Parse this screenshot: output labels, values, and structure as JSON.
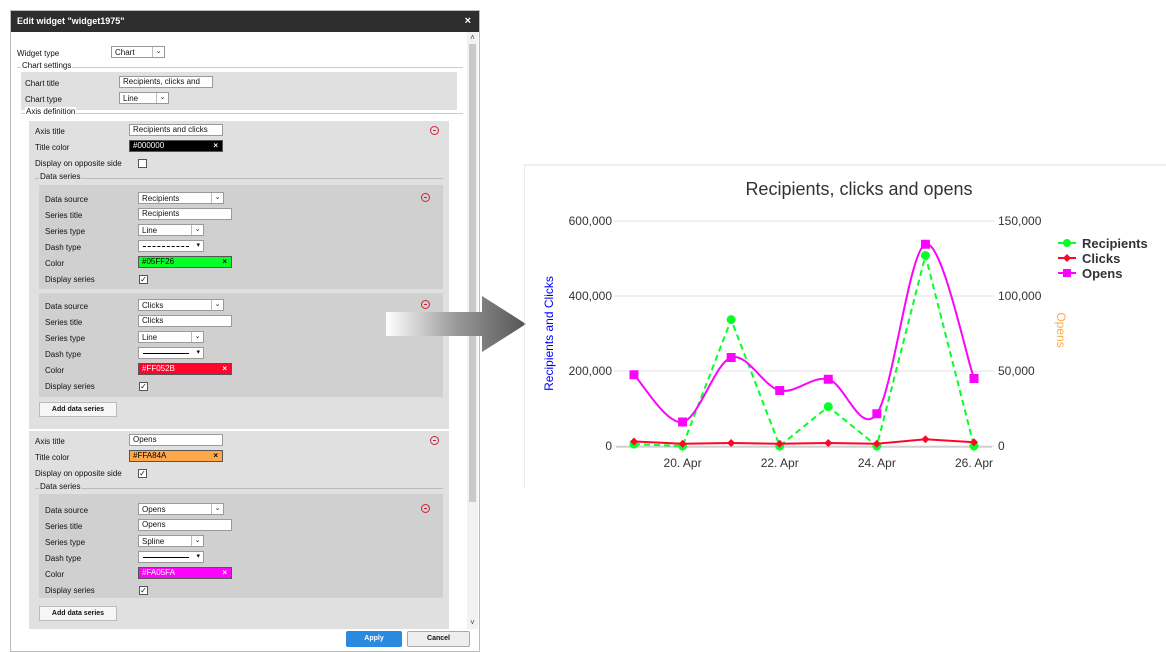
{
  "dialog": {
    "title": "Edit widget \"widget1975\"",
    "close": "×",
    "widget_type_label": "Widget type",
    "widget_type_value": "Chart",
    "chart_settings_legend": "Chart settings",
    "chart_title_label": "Chart title",
    "chart_title_value": "Recipients, clicks and",
    "chart_type_label": "Chart type",
    "chart_type_value": "Line",
    "axis_definition_legend": "Axis definition",
    "axes": [
      {
        "axis_title_label": "Axis title",
        "axis_title_value": "Recipients and clicks",
        "title_color_label": "Title color",
        "title_color_value": "#000000",
        "title_color_hex": "#000000",
        "opposite_label": "Display on opposite side",
        "opposite_checked": "",
        "data_series_legend": "Data series",
        "series": [
          {
            "ds_label": "Data source",
            "ds_value": "Recipients",
            "st_label": "Series title",
            "st_value": "Recipients",
            "type_label": "Series type",
            "type_value": "Line",
            "dash_label": "Dash type",
            "color_label": "Color",
            "color_value": "#05FF26",
            "color_hex": "#05FF26",
            "display_label": "Display series",
            "display_checked": "✓"
          },
          {
            "ds_label": "Data source",
            "ds_value": "Clicks",
            "st_label": "Series title",
            "st_value": "Clicks",
            "type_label": "Series type",
            "type_value": "Line",
            "dash_label": "Dash type",
            "color_label": "Color",
            "color_value": "#FF052B",
            "color_hex": "#FF052B",
            "display_label": "Display series",
            "display_checked": "✓"
          }
        ],
        "add_series": "Add data series"
      },
      {
        "axis_title_label": "Axis title",
        "axis_title_value": "Opens",
        "title_color_label": "Title color",
        "title_color_value": "#FFA84A",
        "title_color_hex": "#FFA84A",
        "opposite_label": "Display on opposite side",
        "opposite_checked": "✓",
        "data_series_legend": "Data series",
        "series": [
          {
            "ds_label": "Data source",
            "ds_value": "Opens",
            "st_label": "Series title",
            "st_value": "Opens",
            "type_label": "Series type",
            "type_value": "Spline",
            "dash_label": "Dash type",
            "color_label": "Color",
            "color_value": "#FA05FA",
            "color_hex": "#FA05FA",
            "display_label": "Display series",
            "display_checked": "✓"
          }
        ],
        "add_series": "Add data series"
      }
    ],
    "apply": "Apply",
    "cancel": "Cancel"
  },
  "chart_data": {
    "type": "line",
    "title": "Recipients, clicks and opens",
    "left_axis_title": "Recipients and Clicks",
    "left_axis_color": "#0000ff",
    "right_axis_title": "Opens",
    "right_axis_color": "#FFA84A",
    "x_tick_labels": [
      "20. Apr",
      "22. Apr",
      "24. Apr",
      "26. Apr"
    ],
    "left_ticks": [
      "0",
      "200,000",
      "400,000",
      "600,000"
    ],
    "right_ticks": [
      "0",
      "50,000",
      "100,000",
      "150,000"
    ],
    "x_range": [
      "19. Apr",
      "26. Apr"
    ],
    "left_ylim": [
      0,
      600000
    ],
    "right_ylim": [
      0,
      150000
    ],
    "grid": true,
    "legend_placement": "top-right",
    "series": [
      {
        "name": "Recipients",
        "axis": "left",
        "color": "#05FF26",
        "style": "dashed",
        "marker": "circle",
        "x": [
          "19. Apr",
          "20. Apr",
          "21. Apr",
          "22. Apr",
          "23. Apr",
          "24. Apr",
          "25. Apr",
          "26. Apr"
        ],
        "y": [
          5000,
          0,
          337000,
          0,
          105000,
          0,
          508000,
          0
        ]
      },
      {
        "name": "Clicks",
        "axis": "left",
        "color": "#FF052B",
        "style": "solid",
        "marker": "diamond",
        "x": [
          "19. Apr",
          "20. Apr",
          "21. Apr",
          "22. Apr",
          "23. Apr",
          "24. Apr",
          "25. Apr",
          "26. Apr"
        ],
        "y": [
          12000,
          6000,
          8000,
          6000,
          8000,
          6000,
          18000,
          10000
        ]
      },
      {
        "name": "Opens",
        "axis": "right",
        "color": "#FA05FA",
        "style": "spline",
        "marker": "square",
        "x": [
          "19. Apr",
          "20. Apr",
          "21. Apr",
          "22. Apr",
          "23. Apr",
          "24. Apr",
          "25. Apr",
          "26. Apr"
        ],
        "y": [
          47500,
          16000,
          59000,
          37000,
          44500,
          21500,
          134500,
          45000
        ]
      }
    ]
  }
}
